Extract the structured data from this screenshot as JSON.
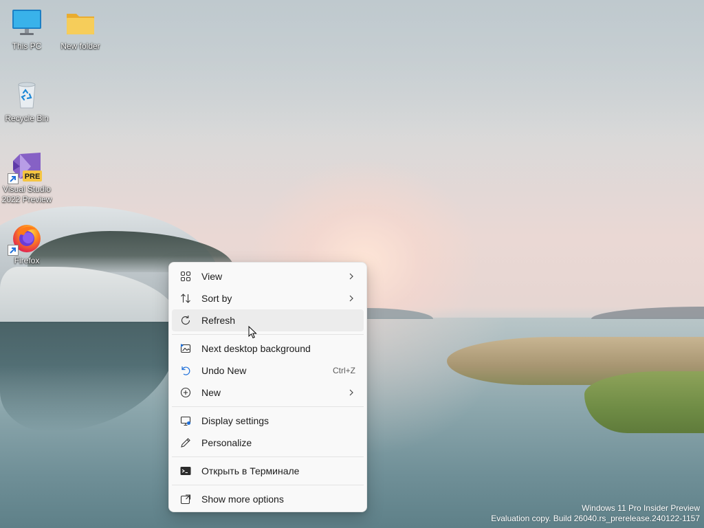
{
  "desktop_icons": [
    {
      "label": "This PC",
      "icon": "monitor-icon"
    },
    {
      "label": "New folder",
      "icon": "folder-icon"
    },
    {
      "label": "Recycle Bin",
      "icon": "recycle-bin-icon"
    },
    {
      "label": "Visual Studio 2022 Preview",
      "label_line1": "Visual Studio",
      "label_line2": "2022 Preview",
      "icon": "visual-studio-icon",
      "badge": "PRE"
    },
    {
      "label": "Firefox",
      "icon": "firefox-icon"
    }
  ],
  "context_menu": {
    "items": [
      {
        "label": "View",
        "icon": "grid-icon",
        "submenu": true
      },
      {
        "label": "Sort by",
        "icon": "sort-icon",
        "submenu": true
      },
      {
        "label": "Refresh",
        "icon": "refresh-icon",
        "submenu": false,
        "hovered": true
      },
      {
        "label": "Next desktop background",
        "icon": "next-background-icon"
      },
      {
        "label": "Undo New",
        "icon": "undo-icon",
        "shortcut": "Ctrl+Z"
      },
      {
        "label": "New",
        "icon": "add-circle-icon",
        "submenu": true
      },
      {
        "label": "Display settings",
        "icon": "display-settings-icon"
      },
      {
        "label": "Personalize",
        "icon": "pen-icon"
      },
      {
        "label": "Открыть в Терминале",
        "icon": "terminal-icon"
      },
      {
        "label": "Show more options",
        "icon": "show-more-icon"
      }
    ]
  },
  "watermark": {
    "line1": "Windows 11 Pro Insider Preview",
    "line2": "Evaluation copy. Build 26040.rs_prerelease.240122-1157"
  },
  "colors": {
    "menu_background": "#f9f9f9",
    "hover": "#ececec",
    "vs_purple": "#8661c5",
    "pre_badge": "#f5c542",
    "folder_yellow": "#f4c542",
    "monitor_blue": "#2a9fd8"
  }
}
